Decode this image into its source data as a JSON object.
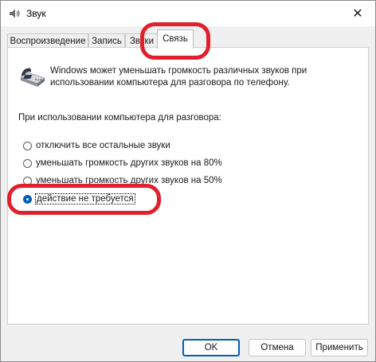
{
  "window": {
    "title": "Звук",
    "app_icon": "speaker-icon",
    "close_icon": "close-icon"
  },
  "tabs": [
    {
      "label": "Воспроизведение",
      "active": false
    },
    {
      "label": "Запись",
      "active": false
    },
    {
      "label": "Звуки",
      "active": false
    },
    {
      "label": "Связь",
      "active": true
    }
  ],
  "communications": {
    "icon": "telephone-icon",
    "description_line1": "Windows может уменьшать громкость различных звуков при",
    "description_line2": "использовании компьютера для разговора по телефону.",
    "section_label": "При использовании компьютера для разговора:",
    "options": [
      {
        "label": "отключить все остальные звуки",
        "checked": false
      },
      {
        "label": "уменьшать громкость других звуков на 80%",
        "checked": false
      },
      {
        "label": "уменьшать громкость других звуков на 50%",
        "checked": false
      },
      {
        "label": "действие не требуется",
        "checked": true
      }
    ]
  },
  "buttons": {
    "ok": "OK",
    "cancel": "Отмена",
    "apply": "Применить"
  },
  "colors": {
    "accent": "#005fb8",
    "annotation": "#e0202c"
  }
}
